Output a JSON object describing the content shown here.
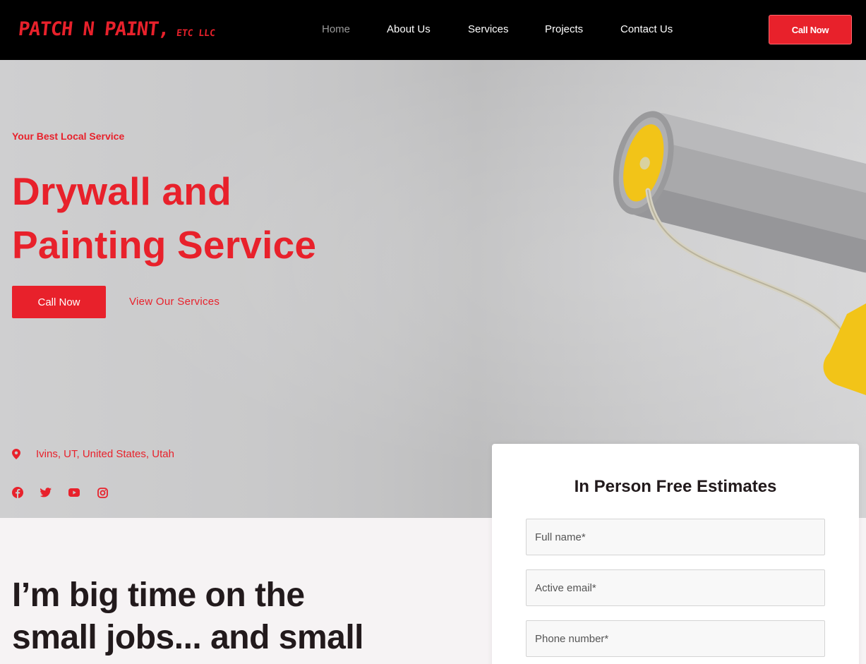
{
  "header": {
    "logo_main": "PATCH N PAINT,",
    "logo_sub": "ETC LLC",
    "nav": [
      {
        "label": "Home",
        "active": true
      },
      {
        "label": "About Us",
        "active": false
      },
      {
        "label": "Services",
        "active": false
      },
      {
        "label": "Projects",
        "active": false
      },
      {
        "label": "Contact Us",
        "active": false
      }
    ],
    "call_button": "Call Now"
  },
  "hero": {
    "tagline": "Your Best Local Service",
    "title_line1": "Drywall and",
    "title_line2": "Painting Service",
    "primary_button": "Call Now",
    "secondary_link": "View Our Services",
    "location": "Ivins, UT, United States, Utah",
    "social_icons": [
      "facebook-icon",
      "twitter-icon",
      "youtube-icon",
      "instagram-icon"
    ]
  },
  "lower": {
    "quote_line1": "I’m big time on the",
    "quote_line2": "small jobs... and small"
  },
  "form": {
    "title": "In Person Free Estimates",
    "full_name_placeholder": "Full name*",
    "email_placeholder": "Active email*",
    "phone_placeholder": "Phone number*"
  },
  "colors": {
    "accent": "#e8212b",
    "header_bg": "#000000",
    "dark_text": "#221a1c",
    "roller_yellow": "#f2c418"
  }
}
